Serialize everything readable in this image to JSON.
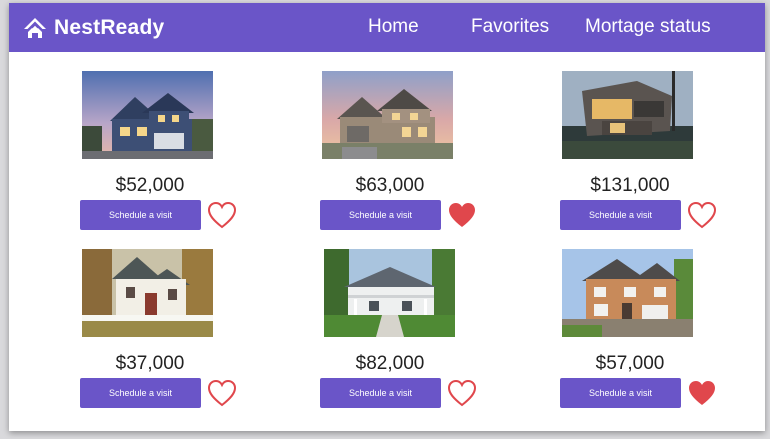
{
  "brand": {
    "name": "NestReady",
    "logo_icon": "house-logo-icon"
  },
  "nav": {
    "items": [
      {
        "label": "Home"
      },
      {
        "label": "Favorites"
      },
      {
        "label": "Mortage status"
      }
    ]
  },
  "colors": {
    "primary": "#6a55c8",
    "heart": "#e0474c",
    "background": "#ffffff"
  },
  "listings": [
    {
      "price": "$52,000",
      "button": "Schedule a visit",
      "favorited": false,
      "photo": "blue-house-dusk"
    },
    {
      "price": "$63,000",
      "button": "Schedule a visit",
      "favorited": true,
      "photo": "stone-house-sunset"
    },
    {
      "price": "$131,000",
      "button": "Schedule a visit",
      "favorited": false,
      "photo": "modern-house-night"
    },
    {
      "price": "$37,000",
      "button": "Schedule a visit",
      "favorited": false,
      "photo": "white-cottage-autumn"
    },
    {
      "price": "$82,000",
      "button": "Schedule a visit",
      "favorited": false,
      "photo": "porch-house-summer"
    },
    {
      "price": "$57,000",
      "button": "Schedule a visit",
      "favorited": true,
      "photo": "brick-house-day"
    }
  ]
}
